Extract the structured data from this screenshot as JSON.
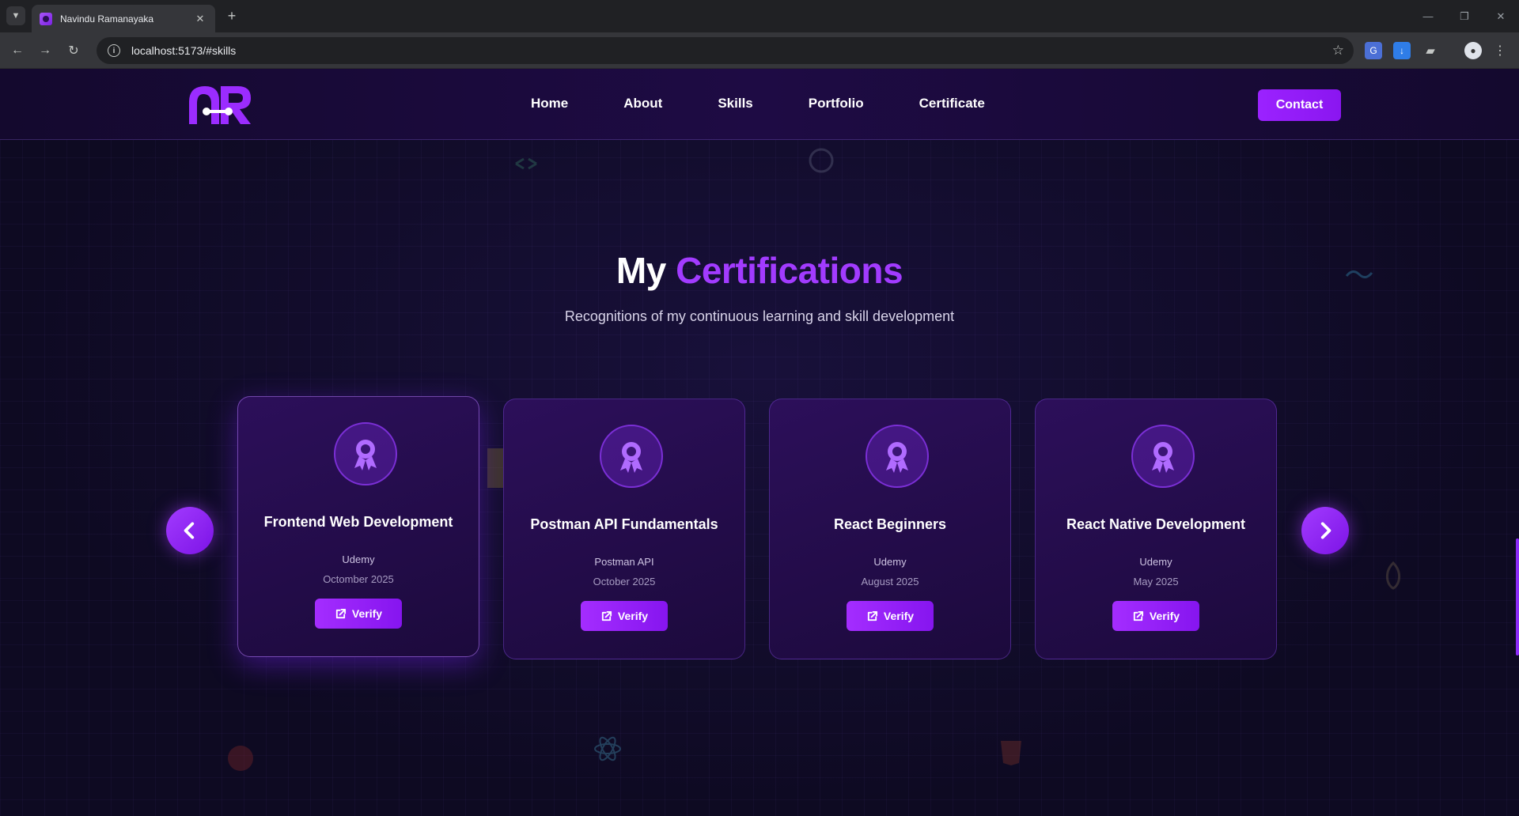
{
  "browser": {
    "tab_title": "Navindu Ramanayaka",
    "url": "localhost:5173/#skills"
  },
  "navbar": {
    "links": [
      "Home",
      "About",
      "Skills",
      "Portfolio",
      "Certificate"
    ],
    "contact_label": "Contact"
  },
  "section": {
    "title_prefix": "My",
    "title_accent": "Certifications",
    "subtitle": "Recognitions of my continuous learning and skill development"
  },
  "certificates": [
    {
      "title": "Frontend Web Development",
      "issuer": "Udemy",
      "date": "Octomber 2025",
      "verify_label": "Verify"
    },
    {
      "title": "Postman API Fundamentals",
      "issuer": "Postman API",
      "date": "October 2025",
      "verify_label": "Verify"
    },
    {
      "title": "React Beginners",
      "issuer": "Udemy",
      "date": "August 2025",
      "verify_label": "Verify"
    },
    {
      "title": "React Native Development",
      "issuer": "Udemy",
      "date": "May 2025",
      "verify_label": "Verify"
    }
  ],
  "colors": {
    "accent": "#a23bff",
    "background": "#0f0a24",
    "card": "#2c0f5a"
  },
  "icons": {
    "badge": "award-ribbon-icon",
    "verify": "external-link-icon",
    "prev": "chevron-left-icon",
    "next": "chevron-right-icon"
  }
}
